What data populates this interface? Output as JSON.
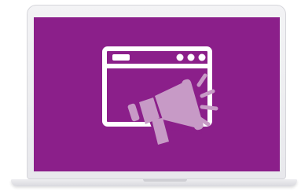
{
  "device": {
    "type": "laptop",
    "screen_color": "#8b1f8a",
    "frame_color": "#eeeef1"
  },
  "illustration": {
    "icons": [
      "browser-window-icon",
      "megaphone-icon",
      "sound-waves-icon"
    ],
    "window_color": "#ffffff",
    "megaphone_color": "#c79ac6"
  }
}
